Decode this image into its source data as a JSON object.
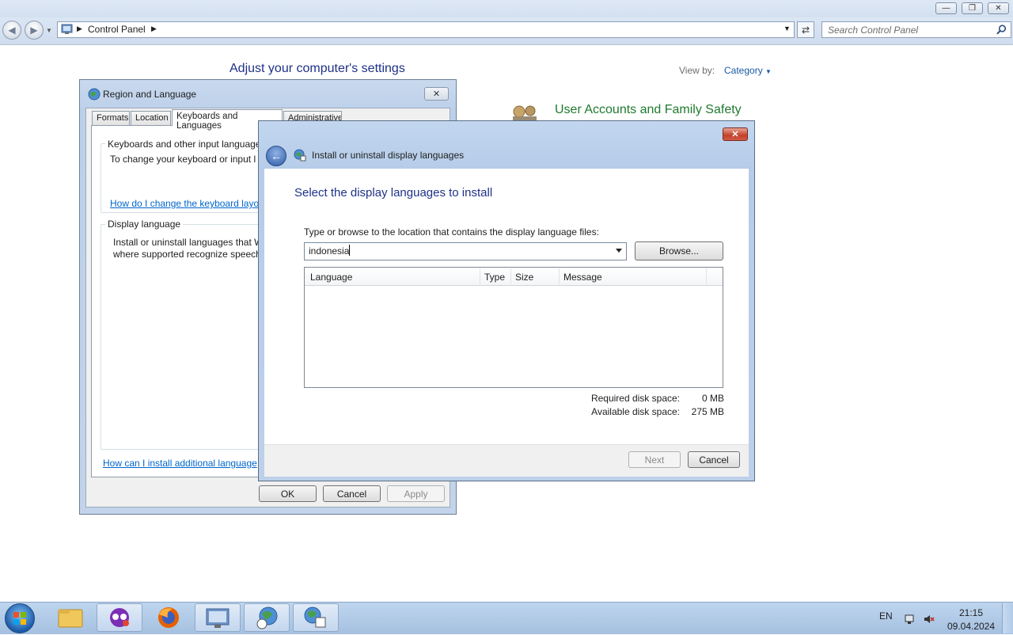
{
  "explorer": {
    "address_crumb": "Control Panel",
    "search_placeholder": "Search Control Panel",
    "heading": "Adjust your computer's settings",
    "view_by_label": "View by:",
    "view_by_value": "Category",
    "category_visible": "User Accounts and Family Safety"
  },
  "region_dialog": {
    "title": "Region and Language",
    "tabs": [
      "Formats",
      "Location",
      "Keyboards and Languages",
      "Administrative"
    ],
    "active_tab": "Keyboards and Languages",
    "keyboards_group_title": "Keyboards and other input language",
    "keyboards_text": "To change your keyboard or input l",
    "keyboards_link": "How do I change the keyboard layo",
    "display_group_title": "Display language",
    "display_text_line1": "Install or uninstall languages that W",
    "display_text_line2": "where supported recognize speech",
    "bottom_link": "How can I install additional language",
    "buttons": {
      "ok": "OK",
      "cancel": "Cancel",
      "apply": "Apply"
    }
  },
  "install_dialog": {
    "title": "Install or uninstall display languages",
    "heading": "Select the display languages to install",
    "location_label": "Type or browse to the location that contains the display language files:",
    "location_value": "indonesia",
    "browse_button": "Browse...",
    "columns": [
      "Language",
      "Type",
      "Size",
      "Message"
    ],
    "rows": [],
    "required_label": "Required disk space:",
    "required_value": "0 MB",
    "available_label": "Available disk space:",
    "available_value": "275 MB",
    "next_button": "Next",
    "cancel_button": "Cancel"
  },
  "taskbar": {
    "language": "EN",
    "time": "21:15",
    "date": "09.04.2024",
    "apps": [
      "start-orb",
      "file-explorer",
      "messenger-app",
      "firefox",
      "control-panel",
      "region-globe",
      "language-install"
    ]
  }
}
